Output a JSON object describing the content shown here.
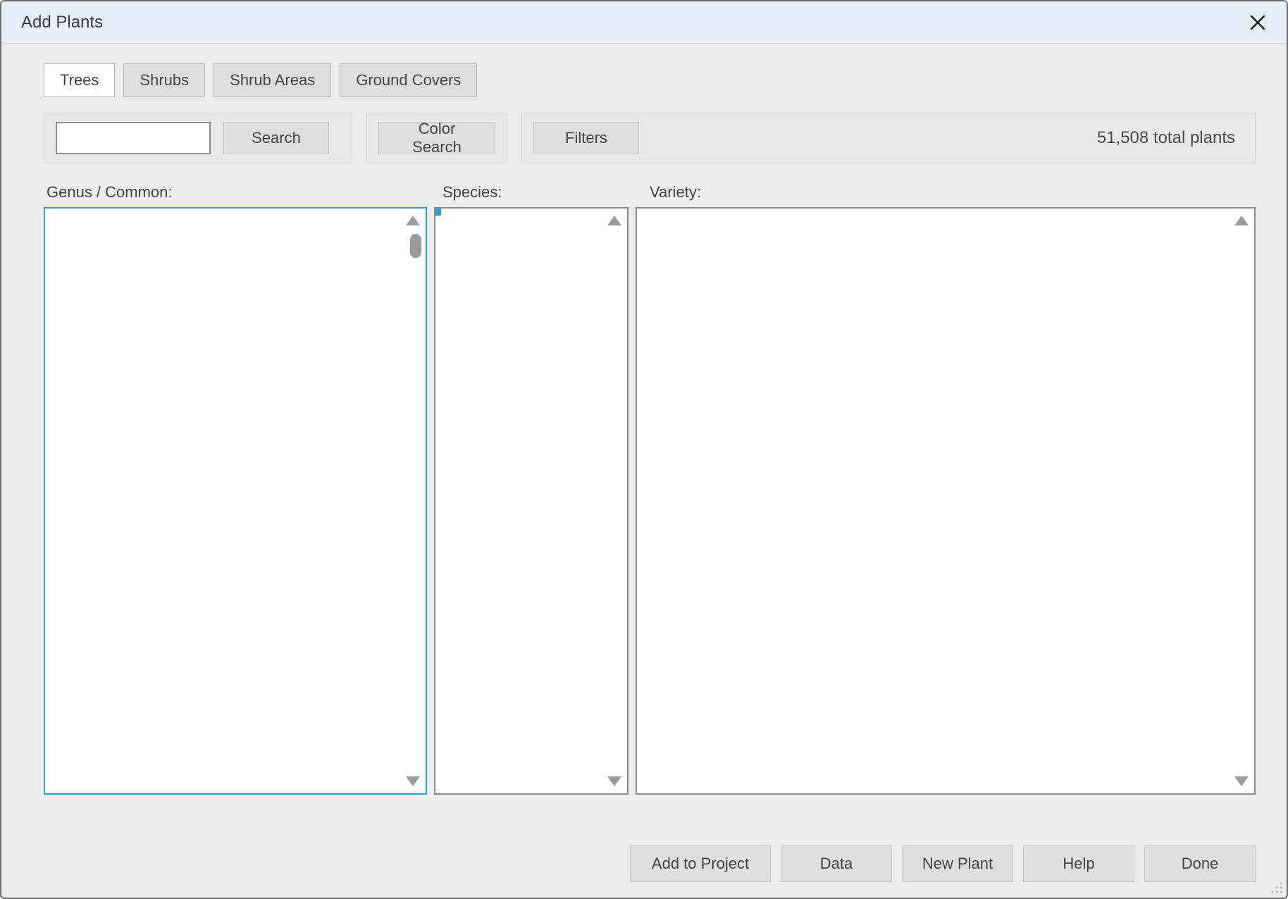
{
  "window": {
    "title": "Add Plants"
  },
  "tabs": {
    "items": [
      {
        "label": "Trees",
        "active": true
      },
      {
        "label": "Shrubs",
        "active": false
      },
      {
        "label": "Shrub Areas",
        "active": false
      },
      {
        "label": "Ground Covers",
        "active": false
      }
    ]
  },
  "search": {
    "input_value": "",
    "search_button": "Search",
    "color_search_button": "Color Search",
    "filters_button": "Filters",
    "total_text": "51,508 total plants"
  },
  "lists": {
    "genus_label": "Genus / Common:",
    "species_label": "Species:",
    "variety_label": "Variety:",
    "genus_items": [],
    "species_items": [],
    "variety_items": []
  },
  "footer": {
    "add_to_project": "Add to Project",
    "data": "Data",
    "new_plant": "New Plant",
    "help": "Help",
    "done": "Done"
  }
}
